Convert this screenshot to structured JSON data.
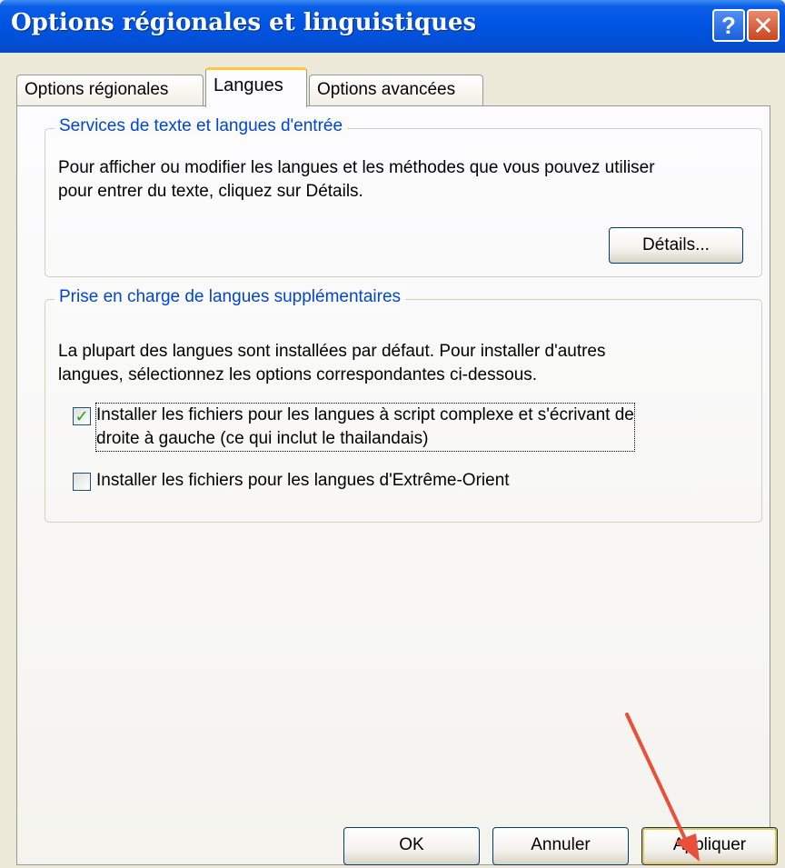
{
  "window": {
    "title": "Options régionales et linguistiques",
    "help_glyph": "?",
    "close_glyph": "✕"
  },
  "tabs": [
    {
      "label": "Options régionales",
      "active": false
    },
    {
      "label": "Langues",
      "active": true
    },
    {
      "label": "Options avancées",
      "active": false
    }
  ],
  "text_services": {
    "title": "Services de texte et langues d'entrée",
    "desc_line1": "Pour afficher ou modifier les langues et les méthodes que vous pouvez utiliser",
    "desc_line2": "pour entrer du texte, cliquez sur Détails.",
    "details_button": "Détails..."
  },
  "supplemental": {
    "title": "Prise en charge de langues supplémentaires",
    "desc_line1": "La plupart des langues sont installées par défaut. Pour installer d'autres",
    "desc_line2": "langues, sélectionnez les options correspondantes ci-dessous.",
    "complex_script": {
      "line1": "Installer les fichiers pour les langues à script complexe et s'écrivant de",
      "line2": "droite à gauche (ce qui inclut le thailandais)",
      "checked": true,
      "check_glyph": "✓"
    },
    "east_asian": {
      "label": "Installer les fichiers pour les langues d'Extrême-Orient",
      "checked": false
    }
  },
  "footer": {
    "ok": "OK",
    "cancel": "Annuler",
    "apply": "Appliquer"
  },
  "annotation": {
    "arrow_color": "#e8503a"
  }
}
